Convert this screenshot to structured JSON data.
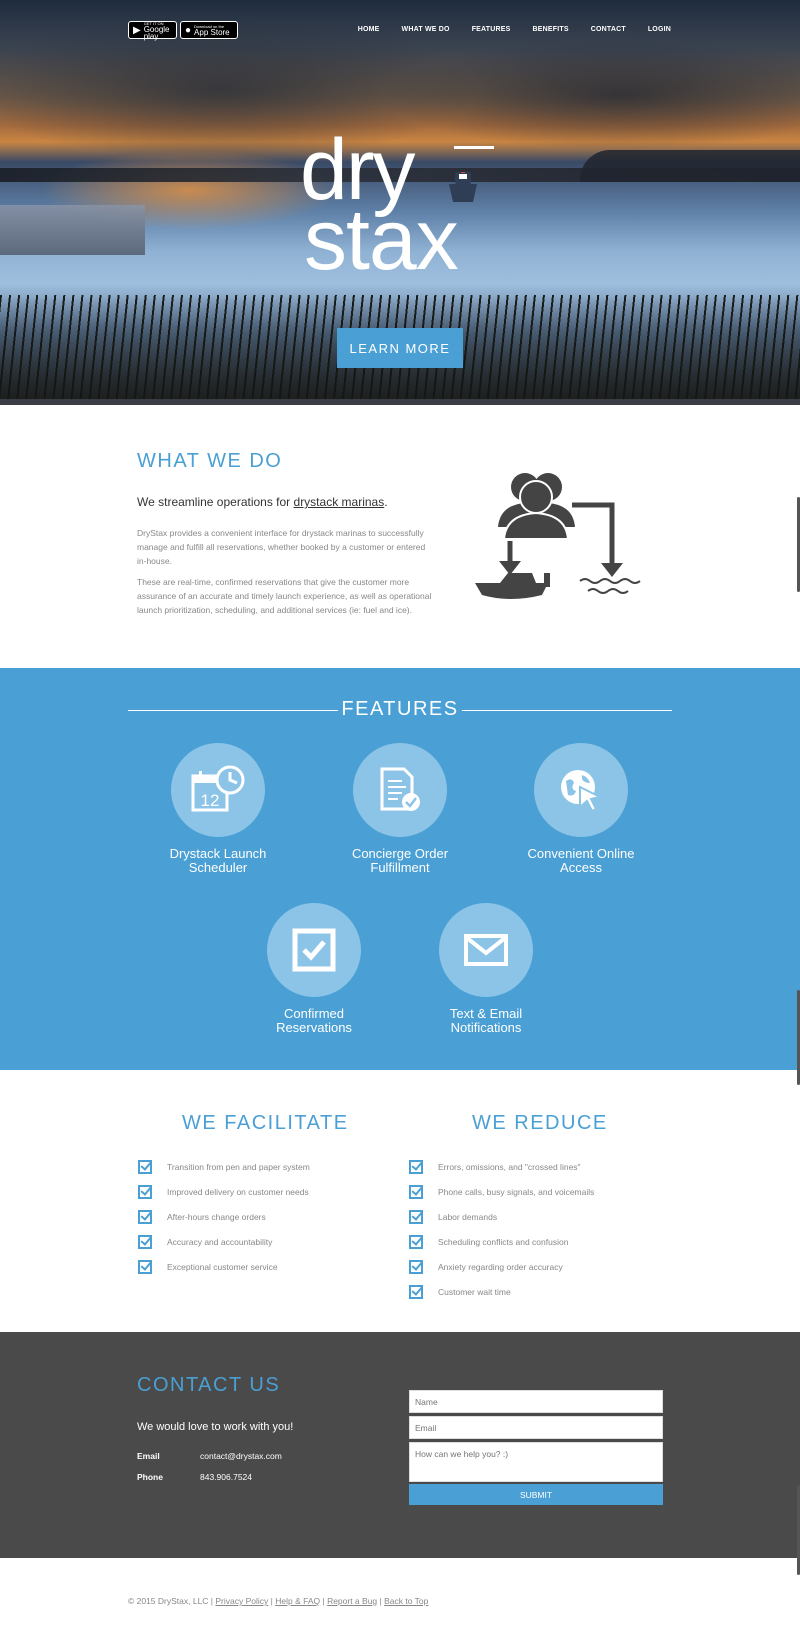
{
  "store_badges": {
    "google_top": "GET IT ON",
    "google_main": "Google play",
    "apple_top": "Download on the",
    "apple_main": "App Store"
  },
  "nav": {
    "items": [
      "HOME",
      "WHAT WE DO",
      "FEATURES",
      "BENEFITS",
      "CONTACT",
      "LOGIN"
    ]
  },
  "logo": {
    "line1": "dry",
    "line2": "stax"
  },
  "hero": {
    "cta_label": "LEARN MORE"
  },
  "what_we_do": {
    "title": "WHAT WE DO",
    "lead_prefix": "We streamline operations for ",
    "lead_link": "drystack marinas",
    "lead_suffix": ".",
    "p1": "DryStax provides a convenient interface for drystack marinas to successfully manage and fulfill all reservations, whether booked by a customer or entered in-house.",
    "p2": "These are real-time, confirmed reservations that give the customer more assurance of an accurate and timely launch experience, as well as operational launch prioritization, scheduling, and additional services (ie: fuel and ice)."
  },
  "features": {
    "title": "FEATURES",
    "items": [
      {
        "line1": "Drystack Launch",
        "line2": "Scheduler",
        "icon": "calendar-clock-icon"
      },
      {
        "line1": "Concierge Order",
        "line2": "Fulfillment",
        "icon": "document-check-icon"
      },
      {
        "line1": "Convenient Online",
        "line2": "Access",
        "icon": "globe-cursor-icon"
      },
      {
        "line1": "Confirmed",
        "line2": "Reservations",
        "icon": "checkbox-icon"
      },
      {
        "line1": "Text & Email",
        "line2": "Notifications",
        "icon": "envelope-icon"
      }
    ],
    "calendar_day": "12"
  },
  "facilitate": {
    "title": "WE FACILITATE",
    "items": [
      "Transition from pen and paper system",
      "Improved delivery on customer needs",
      "After-hours change orders",
      "Accuracy and accountability",
      "Exceptional customer service"
    ]
  },
  "reduce": {
    "title": "WE REDUCE",
    "items": [
      "Errors, omissions, and \"crossed lines\"",
      "Phone calls, busy signals, and voicemails",
      "Labor demands",
      "Scheduling conflicts and confusion",
      "Anxiety regarding order accuracy",
      "Customer wait time"
    ]
  },
  "contact": {
    "title": "CONTACT US",
    "tagline": "We would love to work with you!",
    "email_label": "Email",
    "email_value": "contact@drystax.com",
    "phone_label": "Phone",
    "phone_value": "843.906.7524",
    "name_placeholder": "Name",
    "email_placeholder": "Email",
    "message_placeholder": "How can we help you? :)",
    "submit_label": "SUBMIT"
  },
  "footer": {
    "copyright": "© 2015 DryStax, LLC |",
    "links": [
      "Privacy Policy",
      "Help & FAQ",
      "Report a Bug",
      "Back to Top"
    ]
  },
  "colors": {
    "accent": "#4a9fd4",
    "feature_circle": "#8cc4e8",
    "contact_bg": "#4a4a4a"
  }
}
